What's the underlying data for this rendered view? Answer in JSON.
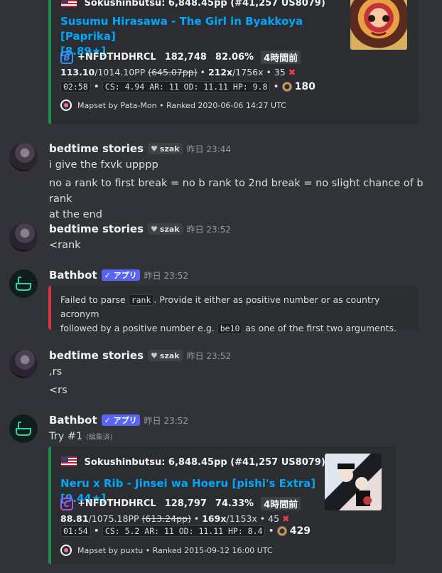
{
  "embed1": {
    "player_line": "Sokushinbutsu: 6,848.45pp (#41,257 US8079)",
    "title": "Susumu Hirasawa - The Girl in Byakkoya [Paprika]",
    "title_2": "[8.89★]",
    "mods": "+NFDTHDHRCL",
    "score": "182,748",
    "acc": "82.06%",
    "ago": "4時間前",
    "pp": "113.10",
    "pp_max": "/1014.10PP",
    "pp_fc": "(645.07pp)",
    "combo": "212x",
    "combo_max": "/1756x",
    "misses": "35",
    "length": "02:58",
    "stats": "CS: 4.94 AR: 11 OD: 11.11 HP: 9.8",
    "count": "180",
    "mapset": "Mapset by Pata-Mon • Ranked 2020-06-06 14:27 UTC",
    "mod_icon": "B"
  },
  "messages": [
    {
      "author": "bedtime stories",
      "tag": "szak",
      "time": "昨日 23:44",
      "lines": [
        "i give the fxvk upppp",
        "no a rank to first break = no b rank to 2nd break = no slight chance of b rank",
        "at the end"
      ]
    },
    {
      "author": "bedtime stories",
      "tag": "szak",
      "time": "昨日 23:52",
      "lines": [
        "<rank"
      ]
    },
    {
      "author": "Bathbot",
      "badge": "✓ アプリ",
      "time": "昨日 23:52"
    },
    {
      "author": "bedtime stories",
      "tag": "szak",
      "time": "昨日 23:52",
      "lines": [
        ",rs",
        "<rs"
      ]
    },
    {
      "author": "Bathbot",
      "badge": "✓ アプリ",
      "time": "昨日 23:52",
      "line": "Try #1",
      "edited": "(編集済)"
    }
  ],
  "error_embed": {
    "part1": "Failed to parse ",
    "code1": "rank",
    "part2": ". Provide it either as positive number or as country acronym",
    "part3": "followed by a positive number e.g. ",
    "code2": "be10",
    "part4": " as one of the first two arguments."
  },
  "embed2": {
    "player_line": "Sokushinbutsu: 6,848.45pp (#41,257 US8079)",
    "title": "Neru x Rib - Jinsei wa Hoeru [pishi's Extra] [9.44★]",
    "mods": "+NFDTHDHRCL",
    "score": "128,797",
    "acc": "74.33%",
    "ago": "4時間前",
    "pp": "88.81",
    "pp_max": "/1075.18PP",
    "pp_fc": "(613.24pp)",
    "combo": "169x",
    "combo_max": "/1153x",
    "misses": "45",
    "length": "01:54",
    "stats": "CS: 5.2 AR: 11 OD: 11.11 HP: 8.4",
    "count": "429",
    "mapset": "Mapset by puxtu • Ranked 2015-09-12 16:00 UTC",
    "mod_icon": "C"
  },
  "colors": {
    "embed_border": "#1f8b4c",
    "error_border": "#da373c",
    "link": "#00a8fc",
    "app_badge": "#5865f2"
  },
  "icons": [
    "us-flag-icon",
    "mod-grade-icon",
    "x-miss-icon",
    "osu-circle-icon",
    "heart-icon",
    "bathtub-icon",
    "verified-check-icon"
  ]
}
